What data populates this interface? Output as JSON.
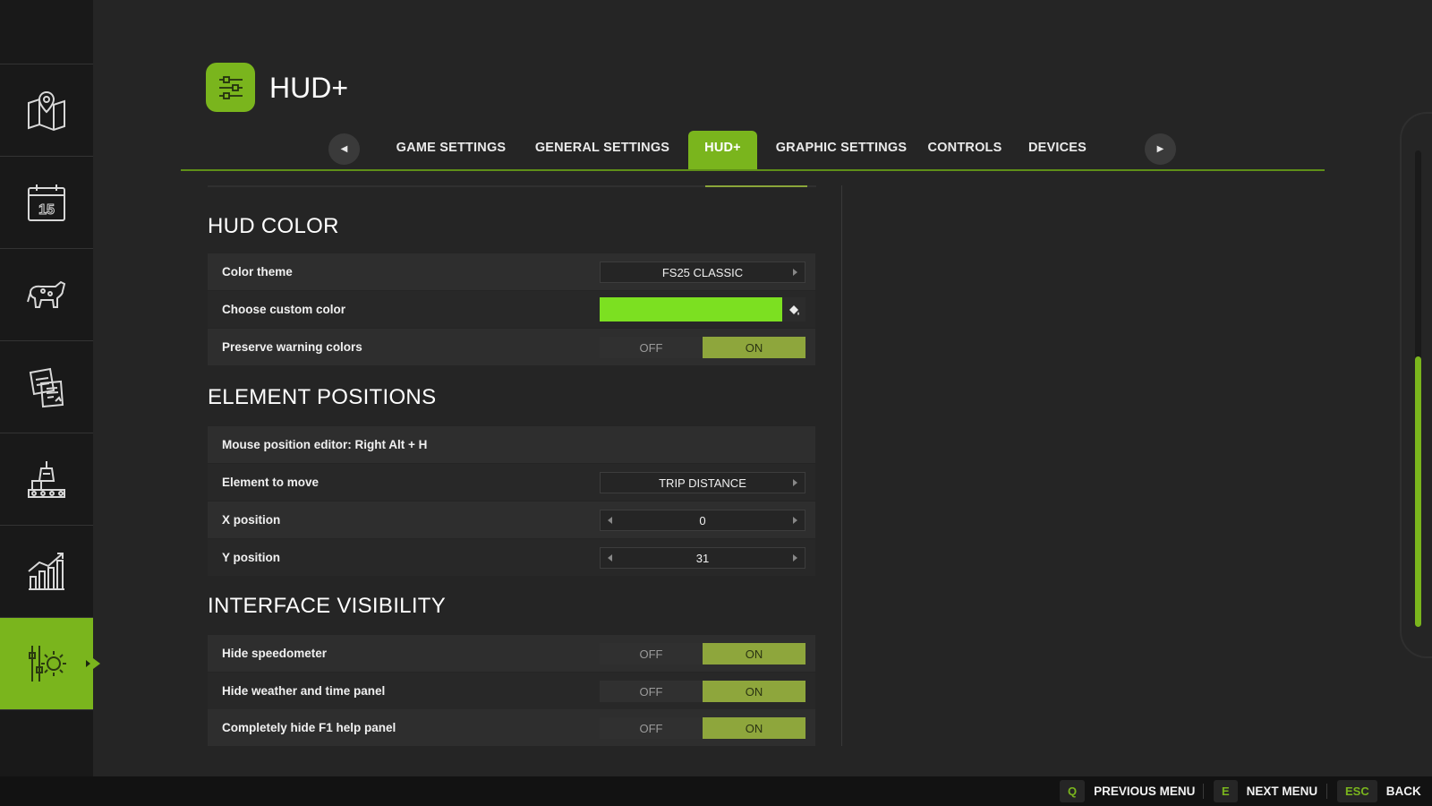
{
  "header": {
    "title": "HUD+"
  },
  "tabs": [
    {
      "label": "GAME SETTINGS",
      "active": false
    },
    {
      "label": "GENERAL SETTINGS",
      "active": false
    },
    {
      "label": "HUD+",
      "active": true
    },
    {
      "label": "GRAPHIC SETTINGS",
      "active": false
    },
    {
      "label": "CONTROLS",
      "active": false
    },
    {
      "label": "DEVICES",
      "active": false
    }
  ],
  "sidebar": {
    "items": [
      {
        "icon": "map-icon"
      },
      {
        "icon": "calendar-icon",
        "text": "15"
      },
      {
        "icon": "animals-icon"
      },
      {
        "icon": "contracts-icon"
      },
      {
        "icon": "production-icon"
      },
      {
        "icon": "statistics-icon"
      },
      {
        "icon": "settings-gear-icon",
        "active": true
      }
    ]
  },
  "sections": {
    "hud_color": {
      "title": "HUD COLOR",
      "color_theme": {
        "label": "Color theme",
        "value": "FS25 CLASSIC"
      },
      "custom_color": {
        "label": "Choose custom color",
        "color": "#7ce021"
      },
      "preserve_warning": {
        "label": "Preserve warning colors",
        "off": "OFF",
        "on": "ON",
        "value": "ON"
      }
    },
    "element_positions": {
      "title": "ELEMENT POSITIONS",
      "mouse_editor": {
        "label": "Mouse position editor: Right Alt + H"
      },
      "element_to_move": {
        "label": "Element to move",
        "value": "TRIP DISTANCE"
      },
      "x_position": {
        "label": "X position",
        "value": "0"
      },
      "y_position": {
        "label": "Y position",
        "value": "31"
      }
    },
    "interface_visibility": {
      "title": "INTERFACE VISIBILITY",
      "hide_speedometer": {
        "label": "Hide speedometer",
        "off": "OFF",
        "on": "ON",
        "value": "ON"
      },
      "hide_weather": {
        "label": "Hide weather and time panel",
        "off": "OFF",
        "on": "ON",
        "value": "ON"
      },
      "hide_f1": {
        "label": "Completely hide F1 help panel",
        "off": "OFF",
        "on": "ON",
        "value": "ON"
      }
    }
  },
  "scroll": {
    "position_fraction": 0.43
  },
  "footer": {
    "hints": [
      {
        "key": "Q",
        "label": "PREVIOUS MENU"
      },
      {
        "key": "E",
        "label": "NEXT MENU"
      },
      {
        "key": "ESC",
        "label": "BACK"
      }
    ]
  },
  "colors": {
    "accent": "#7ab51d",
    "toggle_on": "#8ea63c",
    "background": "#252525"
  }
}
